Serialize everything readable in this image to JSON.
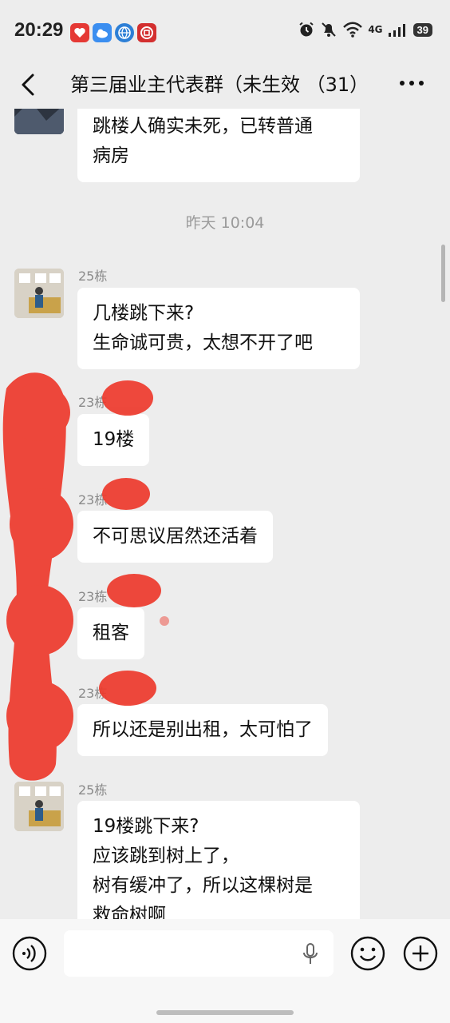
{
  "status_bar": {
    "time": "20:29",
    "network": "4G",
    "battery": "39",
    "icons": [
      "app-icon-red-heart",
      "app-icon-blue-cloud",
      "app-icon-globe",
      "app-icon-red-bank",
      "alarm-icon",
      "mute-icon",
      "wifi-icon",
      "signal-icon"
    ]
  },
  "header": {
    "back_icon": "chevron-left-icon",
    "title": "第三届业主代表群（未生效 （31）",
    "more_icon": "ellipsis-icon"
  },
  "chat": {
    "top_partial_message": {
      "lines": [
        "跳楼人确实未死，已转普通",
        "病房"
      ]
    },
    "timestamp": "昨天 10:04",
    "messages": [
      {
        "sender": "25栋",
        "lines": [
          "几楼跳下来?",
          "生命诚可贵，太想不开了吧"
        ]
      },
      {
        "sender": "23栋",
        "lines": [
          "19楼"
        ]
      },
      {
        "sender": "23栋",
        "lines": [
          "不可思议居然还活着"
        ]
      },
      {
        "sender": "23栋",
        "lines": [
          "租客"
        ]
      },
      {
        "sender": "23栋",
        "lines": [
          "所以还是别出租，太可怕了"
        ]
      },
      {
        "sender": "25栋",
        "lines": [
          "19楼跳下来?",
          "应该跳到树上了，",
          "树有缓冲了，所以这棵树是",
          "救命树啊"
        ]
      }
    ]
  },
  "input_bar": {
    "voice_icon": "voice-icon",
    "mic_icon": "mic-icon",
    "emoji_icon": "emoji-icon",
    "plus_icon": "plus-circle-icon"
  },
  "colors": {
    "background": "#ededed",
    "bubble": "#ffffff",
    "redaction": "#ee3a2c"
  }
}
